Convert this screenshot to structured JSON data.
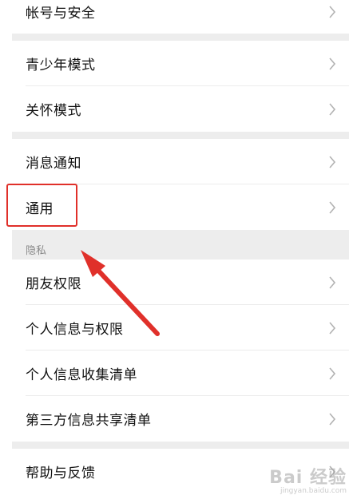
{
  "settings": {
    "group1": [
      {
        "label": "帐号与安全",
        "name": "account-security"
      }
    ],
    "group2": [
      {
        "label": "青少年模式",
        "name": "teen-mode"
      },
      {
        "label": "关怀模式",
        "name": "care-mode"
      }
    ],
    "group3": [
      {
        "label": "消息通知",
        "name": "notifications"
      },
      {
        "label": "通用",
        "name": "general"
      }
    ],
    "privacy_header": "隐私",
    "group4": [
      {
        "label": "朋友权限",
        "name": "friend-permissions"
      },
      {
        "label": "个人信息与权限",
        "name": "personal-info-permissions"
      },
      {
        "label": "个人信息收集清单",
        "name": "personal-info-collection"
      },
      {
        "label": "第三方信息共享清单",
        "name": "third-party-sharing"
      }
    ],
    "group5": [
      {
        "label": "帮助与反馈",
        "name": "help-feedback"
      }
    ]
  },
  "annotation": {
    "highlight_color": "#e0302a"
  },
  "watermark": {
    "text": "Bai 经验",
    "sub": "jingyan.baidu.com"
  },
  "icons": {
    "chevron": "chevron-right-icon",
    "arrow": "red-arrow-icon"
  }
}
